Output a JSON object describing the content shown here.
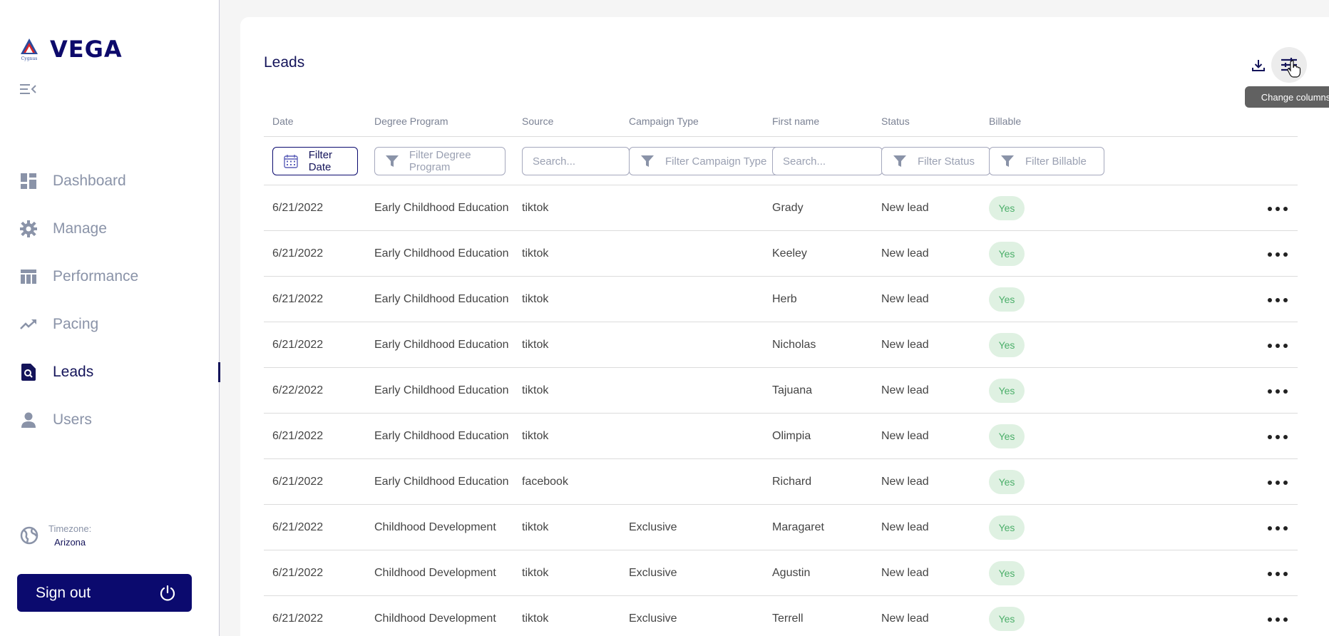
{
  "brand": {
    "name": "VEGA",
    "logo_text": "Cygnus"
  },
  "nav": {
    "items": [
      {
        "label": "Dashboard",
        "icon": "dashboard-icon"
      },
      {
        "label": "Manage",
        "icon": "gear-icon"
      },
      {
        "label": "Performance",
        "icon": "table-icon"
      },
      {
        "label": "Pacing",
        "icon": "trending-up-icon"
      },
      {
        "label": "Leads",
        "icon": "leads-search-icon",
        "active": true
      },
      {
        "label": "Users",
        "icon": "user-icon"
      }
    ]
  },
  "timezone": {
    "label": "Timezone:",
    "value": "Arizona"
  },
  "signout": {
    "label": "Sign out"
  },
  "main": {
    "title": "Leads",
    "tooltip": "Change columns",
    "columns": [
      "Date",
      "Degree Program",
      "Source",
      "Campaign Type",
      "First name",
      "Status",
      "Billable"
    ],
    "filters": {
      "date": "Filter Date",
      "degree_program": "Filter Degree Program",
      "source_placeholder": "Search...",
      "campaign_type": "Filter Campaign Type",
      "first_name_placeholder": "Search...",
      "status": "Filter Status",
      "billable": "Filter Billable"
    },
    "rows": [
      {
        "date": "6/21/2022",
        "program": "Early Childhood Education",
        "source": "tiktok",
        "campaign": "",
        "first_name": "Grady",
        "status": "New lead",
        "billable": "Yes"
      },
      {
        "date": "6/21/2022",
        "program": "Early Childhood Education",
        "source": "tiktok",
        "campaign": "",
        "first_name": "Keeley",
        "status": "New lead",
        "billable": "Yes"
      },
      {
        "date": "6/21/2022",
        "program": "Early Childhood Education",
        "source": "tiktok",
        "campaign": "",
        "first_name": "Herb",
        "status": "New lead",
        "billable": "Yes"
      },
      {
        "date": "6/21/2022",
        "program": "Early Childhood Education",
        "source": "tiktok",
        "campaign": "",
        "first_name": "Nicholas",
        "status": "New lead",
        "billable": "Yes"
      },
      {
        "date": "6/22/2022",
        "program": "Early Childhood Education",
        "source": "tiktok",
        "campaign": "",
        "first_name": "Tajuana",
        "status": "New lead",
        "billable": "Yes"
      },
      {
        "date": "6/21/2022",
        "program": "Early Childhood Education",
        "source": "tiktok",
        "campaign": "",
        "first_name": "Olimpia",
        "status": "New lead",
        "billable": "Yes"
      },
      {
        "date": "6/21/2022",
        "program": "Early Childhood Education",
        "source": "facebook",
        "campaign": "",
        "first_name": "Richard",
        "status": "New lead",
        "billable": "Yes"
      },
      {
        "date": "6/21/2022",
        "program": "Childhood Development",
        "source": "tiktok",
        "campaign": "Exclusive",
        "first_name": "Maragaret",
        "status": "New lead",
        "billable": "Yes"
      },
      {
        "date": "6/21/2022",
        "program": "Childhood Development",
        "source": "tiktok",
        "campaign": "Exclusive",
        "first_name": "Agustin",
        "status": "New lead",
        "billable": "Yes"
      },
      {
        "date": "6/21/2022",
        "program": "Childhood Development",
        "source": "tiktok",
        "campaign": "Exclusive",
        "first_name": "Terrell",
        "status": "New lead",
        "billable": "Yes"
      }
    ]
  },
  "colors": {
    "brand_navy": "#0b0a6e",
    "nav_inactive": "#8a93a8",
    "badge_bg": "#dff1e2",
    "badge_text": "#4caf6a"
  }
}
